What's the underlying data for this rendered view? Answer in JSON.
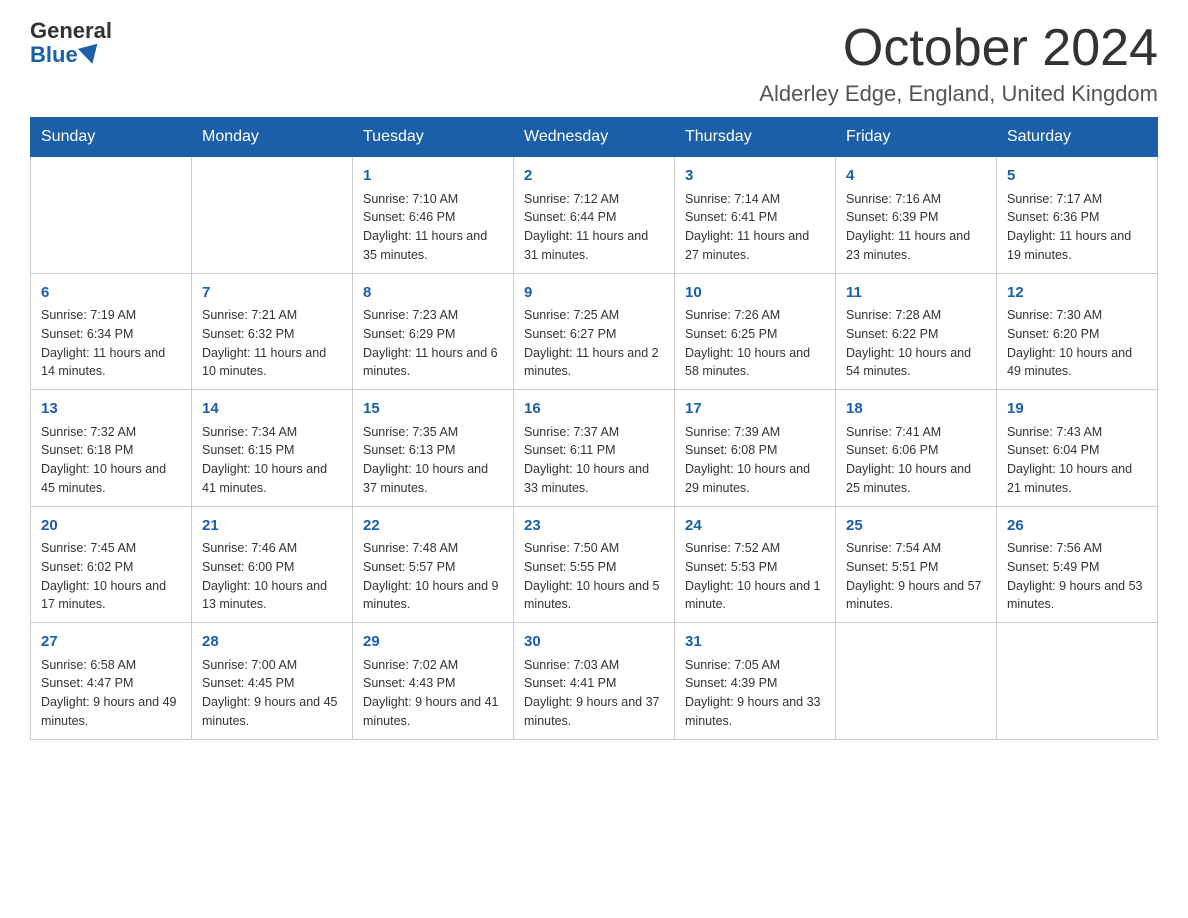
{
  "header": {
    "logo_general": "General",
    "logo_blue": "Blue",
    "month_title": "October 2024",
    "location": "Alderley Edge, England, United Kingdom"
  },
  "days_of_week": [
    "Sunday",
    "Monday",
    "Tuesday",
    "Wednesday",
    "Thursday",
    "Friday",
    "Saturday"
  ],
  "weeks": [
    [
      {
        "day": "",
        "info": ""
      },
      {
        "day": "",
        "info": ""
      },
      {
        "day": "1",
        "info": "Sunrise: 7:10 AM\nSunset: 6:46 PM\nDaylight: 11 hours\nand 35 minutes."
      },
      {
        "day": "2",
        "info": "Sunrise: 7:12 AM\nSunset: 6:44 PM\nDaylight: 11 hours\nand 31 minutes."
      },
      {
        "day": "3",
        "info": "Sunrise: 7:14 AM\nSunset: 6:41 PM\nDaylight: 11 hours\nand 27 minutes."
      },
      {
        "day": "4",
        "info": "Sunrise: 7:16 AM\nSunset: 6:39 PM\nDaylight: 11 hours\nand 23 minutes."
      },
      {
        "day": "5",
        "info": "Sunrise: 7:17 AM\nSunset: 6:36 PM\nDaylight: 11 hours\nand 19 minutes."
      }
    ],
    [
      {
        "day": "6",
        "info": "Sunrise: 7:19 AM\nSunset: 6:34 PM\nDaylight: 11 hours\nand 14 minutes."
      },
      {
        "day": "7",
        "info": "Sunrise: 7:21 AM\nSunset: 6:32 PM\nDaylight: 11 hours\nand 10 minutes."
      },
      {
        "day": "8",
        "info": "Sunrise: 7:23 AM\nSunset: 6:29 PM\nDaylight: 11 hours\nand 6 minutes."
      },
      {
        "day": "9",
        "info": "Sunrise: 7:25 AM\nSunset: 6:27 PM\nDaylight: 11 hours\nand 2 minutes."
      },
      {
        "day": "10",
        "info": "Sunrise: 7:26 AM\nSunset: 6:25 PM\nDaylight: 10 hours\nand 58 minutes."
      },
      {
        "day": "11",
        "info": "Sunrise: 7:28 AM\nSunset: 6:22 PM\nDaylight: 10 hours\nand 54 minutes."
      },
      {
        "day": "12",
        "info": "Sunrise: 7:30 AM\nSunset: 6:20 PM\nDaylight: 10 hours\nand 49 minutes."
      }
    ],
    [
      {
        "day": "13",
        "info": "Sunrise: 7:32 AM\nSunset: 6:18 PM\nDaylight: 10 hours\nand 45 minutes."
      },
      {
        "day": "14",
        "info": "Sunrise: 7:34 AM\nSunset: 6:15 PM\nDaylight: 10 hours\nand 41 minutes."
      },
      {
        "day": "15",
        "info": "Sunrise: 7:35 AM\nSunset: 6:13 PM\nDaylight: 10 hours\nand 37 minutes."
      },
      {
        "day": "16",
        "info": "Sunrise: 7:37 AM\nSunset: 6:11 PM\nDaylight: 10 hours\nand 33 minutes."
      },
      {
        "day": "17",
        "info": "Sunrise: 7:39 AM\nSunset: 6:08 PM\nDaylight: 10 hours\nand 29 minutes."
      },
      {
        "day": "18",
        "info": "Sunrise: 7:41 AM\nSunset: 6:06 PM\nDaylight: 10 hours\nand 25 minutes."
      },
      {
        "day": "19",
        "info": "Sunrise: 7:43 AM\nSunset: 6:04 PM\nDaylight: 10 hours\nand 21 minutes."
      }
    ],
    [
      {
        "day": "20",
        "info": "Sunrise: 7:45 AM\nSunset: 6:02 PM\nDaylight: 10 hours\nand 17 minutes."
      },
      {
        "day": "21",
        "info": "Sunrise: 7:46 AM\nSunset: 6:00 PM\nDaylight: 10 hours\nand 13 minutes."
      },
      {
        "day": "22",
        "info": "Sunrise: 7:48 AM\nSunset: 5:57 PM\nDaylight: 10 hours\nand 9 minutes."
      },
      {
        "day": "23",
        "info": "Sunrise: 7:50 AM\nSunset: 5:55 PM\nDaylight: 10 hours\nand 5 minutes."
      },
      {
        "day": "24",
        "info": "Sunrise: 7:52 AM\nSunset: 5:53 PM\nDaylight: 10 hours\nand 1 minute."
      },
      {
        "day": "25",
        "info": "Sunrise: 7:54 AM\nSunset: 5:51 PM\nDaylight: 9 hours\nand 57 minutes."
      },
      {
        "day": "26",
        "info": "Sunrise: 7:56 AM\nSunset: 5:49 PM\nDaylight: 9 hours\nand 53 minutes."
      }
    ],
    [
      {
        "day": "27",
        "info": "Sunrise: 6:58 AM\nSunset: 4:47 PM\nDaylight: 9 hours\nand 49 minutes."
      },
      {
        "day": "28",
        "info": "Sunrise: 7:00 AM\nSunset: 4:45 PM\nDaylight: 9 hours\nand 45 minutes."
      },
      {
        "day": "29",
        "info": "Sunrise: 7:02 AM\nSunset: 4:43 PM\nDaylight: 9 hours\nand 41 minutes."
      },
      {
        "day": "30",
        "info": "Sunrise: 7:03 AM\nSunset: 4:41 PM\nDaylight: 9 hours\nand 37 minutes."
      },
      {
        "day": "31",
        "info": "Sunrise: 7:05 AM\nSunset: 4:39 PM\nDaylight: 9 hours\nand 33 minutes."
      },
      {
        "day": "",
        "info": ""
      },
      {
        "day": "",
        "info": ""
      }
    ]
  ]
}
